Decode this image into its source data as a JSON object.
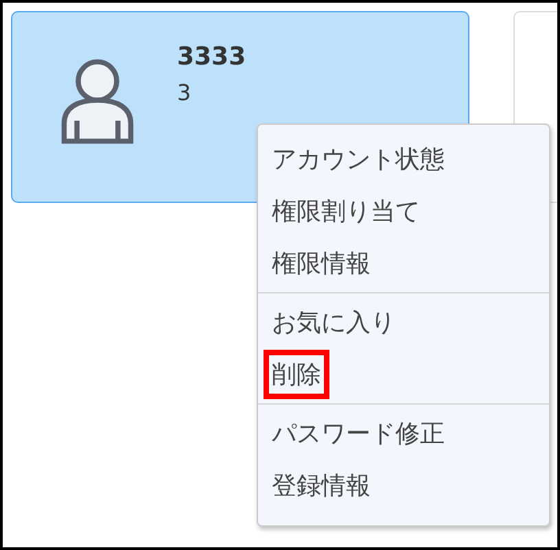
{
  "cards": [
    {
      "title": "3333",
      "subtitle": "3",
      "selected": true
    },
    {
      "selected": false
    }
  ],
  "context_menu": {
    "groups": [
      {
        "items": [
          {
            "label": "アカウント状態",
            "highlighted": false
          },
          {
            "label": "権限割り当て",
            "highlighted": false
          },
          {
            "label": "権限情報",
            "highlighted": false
          }
        ]
      },
      {
        "items": [
          {
            "label": "お気に入り",
            "highlighted": false
          },
          {
            "label": "削除",
            "highlighted": true
          }
        ]
      },
      {
        "items": [
          {
            "label": "パスワード修正",
            "highlighted": false
          },
          {
            "label": "登録情報",
            "highlighted": false
          }
        ]
      }
    ]
  }
}
